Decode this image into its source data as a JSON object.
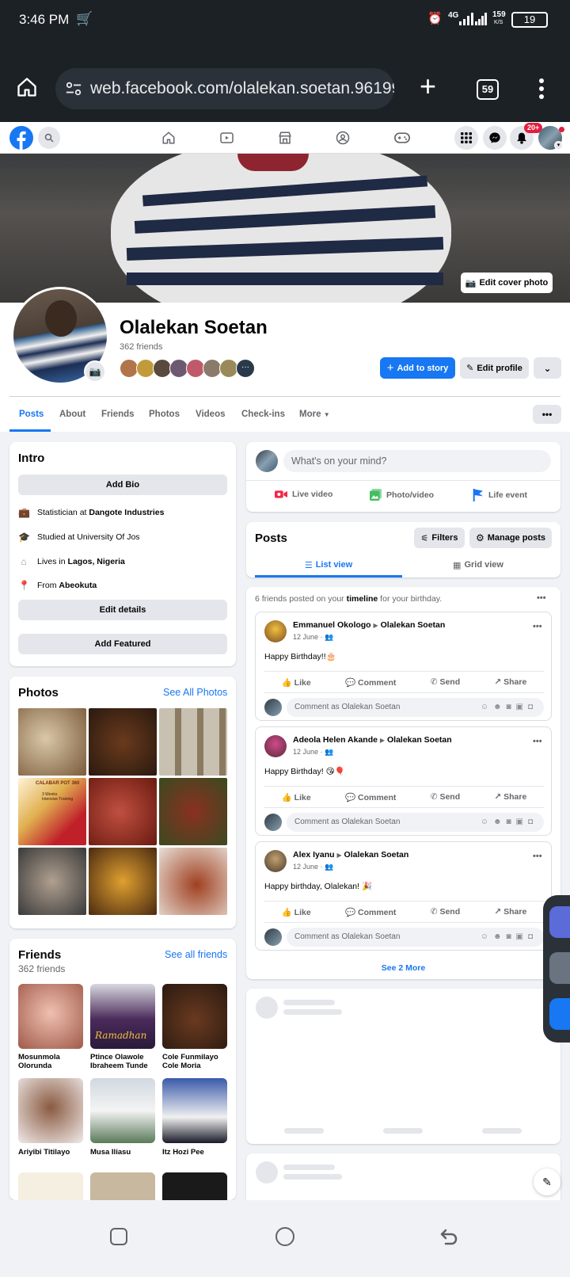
{
  "status": {
    "time": "3:46 PM",
    "network": "4G",
    "speed": "159",
    "speed_unit": "K/S",
    "battery": "19"
  },
  "browser": {
    "url": "web.facebook.com/olalekan.soetan.96199:",
    "tab_count": "59"
  },
  "fb": {
    "notif_badge": "20+"
  },
  "cover": {
    "edit_label": "Edit cover photo"
  },
  "profile": {
    "name": "Olalekan Soetan",
    "friends_count": "362 friends",
    "add_story": "Add to story",
    "edit_profile": "Edit profile"
  },
  "tabs": [
    "Posts",
    "About",
    "Friends",
    "Photos",
    "Videos",
    "Check-ins",
    "More"
  ],
  "intro": {
    "title": "Intro",
    "add_bio": "Add Bio",
    "work_prefix": "Statistician at ",
    "work_place": "Dangote Industries",
    "studied": "Studied at University Of Jos",
    "lives_prefix": "Lives in ",
    "lives_place": "Lagos, Nigeria",
    "from_prefix": "From ",
    "from_place": "Abeokuta",
    "edit_details": "Edit details",
    "add_featured": "Add Featured"
  },
  "photos": {
    "title": "Photos",
    "see_all": "See All Photos",
    "flyer_title": "CALABAR POT 360",
    "flyer_sub": "3 Weeks Intensive Training"
  },
  "friends": {
    "title": "Friends",
    "see_all": "See all friends",
    "count": "362 friends",
    "list": [
      "Mosunmola Olorunda",
      "Ptince Olawole Ibraheem Tunde",
      "Cole Funmilayo Cole Moria",
      "Ariyibi Titilayo",
      "Musa Iliasu",
      "Itz Hozi Pee"
    ],
    "ramadan": "Ramadhan"
  },
  "composer": {
    "placeholder": "What's on your mind?",
    "live": "Live video",
    "photo": "Photo/video",
    "life": "Life event"
  },
  "posts_header": {
    "title": "Posts",
    "filters": "Filters",
    "manage": "Manage posts",
    "list_view": "List view",
    "grid_view": "Grid view"
  },
  "birthday": {
    "summary_prefix": "6 friends posted on your ",
    "summary_bold": "timeline",
    "summary_suffix": " for your birthday.",
    "see_more": "See 2 More",
    "actions": {
      "like": "Like",
      "comment": "Comment",
      "send": "Send",
      "share": "Share"
    },
    "comment_placeholder": "Comment as Olalekan Soetan",
    "posts": [
      {
        "author": "Emmanuel Okologo",
        "target": "Olalekan Soetan",
        "date": "12 June ·",
        "text": "Happy Birthday!!🎂"
      },
      {
        "author": "Adeola Helen Akande",
        "target": "Olalekan Soetan",
        "date": "12 June ·",
        "text": "Happy Birthday! 😘🎈"
      },
      {
        "author": "Alex Iyanu",
        "target": "Olalekan Soetan",
        "date": "12 June ·",
        "text": "Happy birthday, Olalekan! 🎉"
      }
    ]
  },
  "colors": {
    "fb_blue": "#1877f2",
    "status_bg": "#1c2126",
    "live_red": "#f02849",
    "photo_green": "#45bd62",
    "life_blue": "#1877f2"
  }
}
